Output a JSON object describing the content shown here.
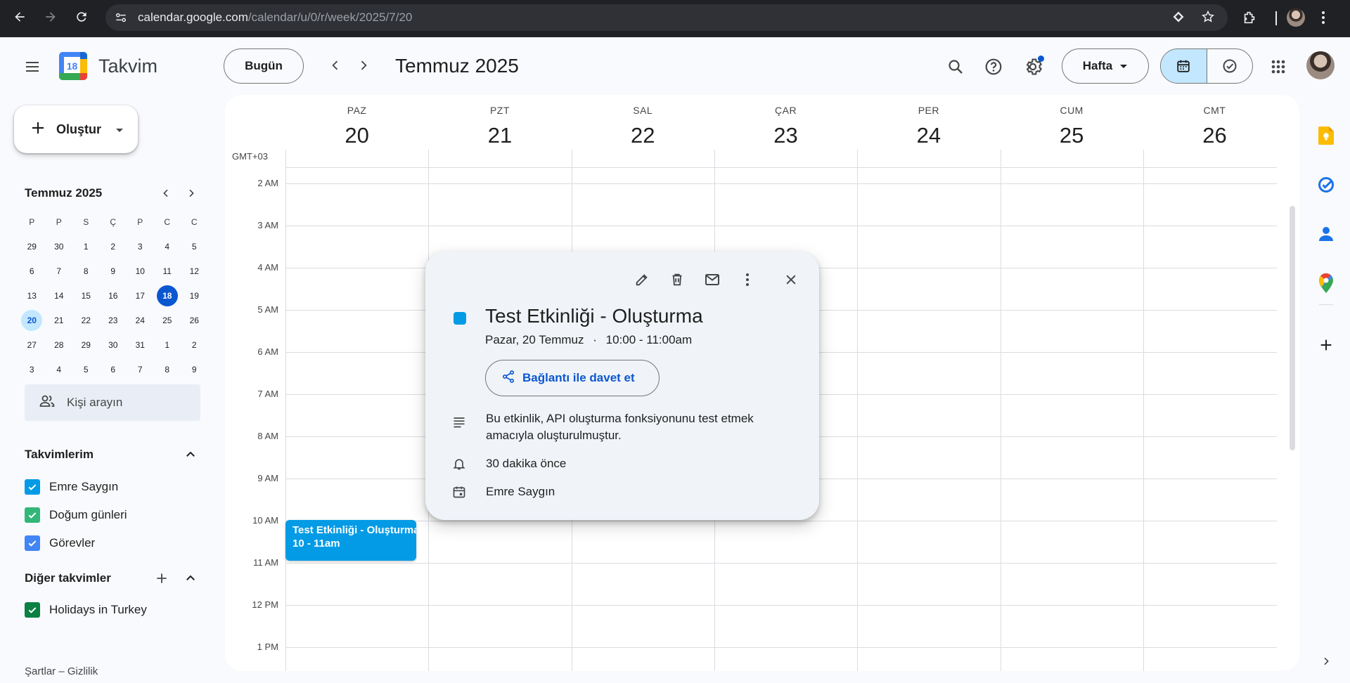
{
  "browser": {
    "url_host": "calendar.google.com",
    "url_path": "/calendar/u/0/r/week/2025/7/20"
  },
  "header": {
    "app_name": "Takvim",
    "logo_day": "18",
    "today_label": "Bugün",
    "current_period": "Temmuz 2025",
    "view_label": "Hafta"
  },
  "sidebar": {
    "create_label": "Oluştur",
    "mini_calendar": {
      "title": "Temmuz 2025",
      "weekdays": [
        "P",
        "P",
        "S",
        "Ç",
        "P",
        "C",
        "C"
      ],
      "weeks": [
        [
          "29",
          "30",
          "1",
          "2",
          "3",
          "4",
          "5"
        ],
        [
          "6",
          "7",
          "8",
          "9",
          "10",
          "11",
          "12"
        ],
        [
          "13",
          "14",
          "15",
          "16",
          "17",
          "18",
          "19"
        ],
        [
          "20",
          "21",
          "22",
          "23",
          "24",
          "25",
          "26"
        ],
        [
          "27",
          "28",
          "29",
          "30",
          "31",
          "1",
          "2"
        ],
        [
          "3",
          "4",
          "5",
          "6",
          "7",
          "8",
          "9"
        ]
      ],
      "today": "18",
      "selected": "20"
    },
    "people_search_placeholder": "Kişi arayın",
    "my_calendars_title": "Takvimlerim",
    "my_calendars": [
      {
        "label": "Emre Saygın",
        "color": "#039be5"
      },
      {
        "label": "Doğum günleri",
        "color": "#33b679"
      },
      {
        "label": "Görevler",
        "color": "#4285f4"
      }
    ],
    "other_calendars_title": "Diğer takvimler",
    "other_calendars": [
      {
        "label": "Holidays in Turkey",
        "color": "#0b8043"
      }
    ],
    "footer_terms": "Şartlar",
    "footer_sep": " – ",
    "footer_privacy": "Gizlilik"
  },
  "week": {
    "timezone": "GMT+03",
    "days": [
      {
        "dow": "PAZ",
        "num": "20"
      },
      {
        "dow": "PZT",
        "num": "21"
      },
      {
        "dow": "SAL",
        "num": "22"
      },
      {
        "dow": "ÇAR",
        "num": "23"
      },
      {
        "dow": "PER",
        "num": "24"
      },
      {
        "dow": "CUM",
        "num": "25"
      },
      {
        "dow": "CMT",
        "num": "26"
      }
    ],
    "hours": [
      "2 AM",
      "3 AM",
      "4 AM",
      "5 AM",
      "6 AM",
      "7 AM",
      "8 AM",
      "9 AM",
      "10 AM",
      "11 AM",
      "12 PM",
      "1 PM"
    ]
  },
  "event": {
    "chip_title": "Test Etkinliği - Oluşturma",
    "chip_time": "10 - 11am",
    "color": "#039be5"
  },
  "popup": {
    "title": "Test Etkinliği - Oluşturma",
    "date": "Pazar, 20 Temmuz",
    "dot": "·",
    "time": "10:00 - 11:00am",
    "invite_label": "Bağlantı ile davet et",
    "description": "Bu etkinlik, API oluşturma fonksiyonunu test etmek amacıyla oluşturulmuştur.",
    "reminder": "30 dakika önce",
    "calendar": "Emre Saygın"
  },
  "colors": {
    "accent": "#0b57d0",
    "selected_bg": "#c2e7ff"
  }
}
